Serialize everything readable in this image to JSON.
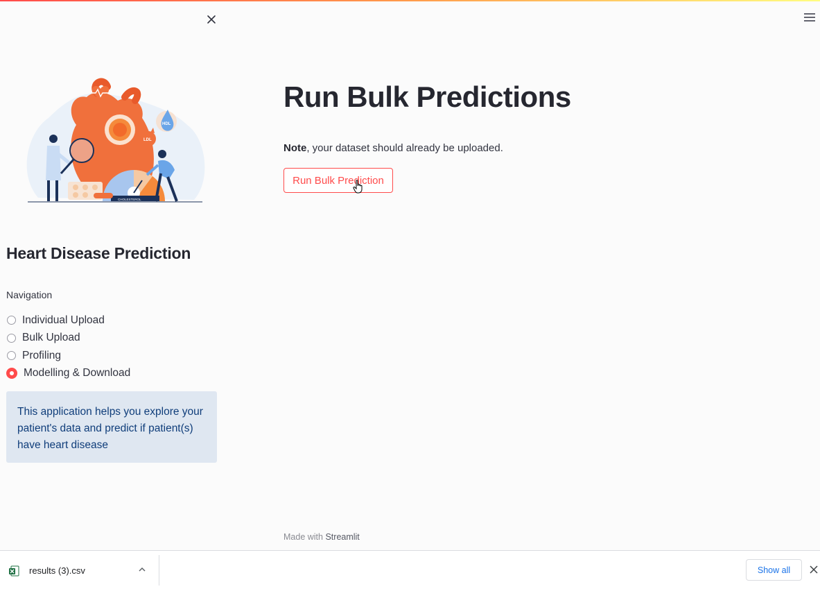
{
  "sidebar": {
    "title": "Heart Disease Prediction",
    "nav_label": "Navigation",
    "options": [
      "Individual Upload",
      "Bulk Upload",
      "Profiling",
      "Modelling & Download"
    ],
    "selected": "Modelling & Download",
    "info": "This application helps you explore your patient's data and predict if patient(s) have heart disease",
    "illustration_texts": {
      "hdl": "HDL",
      "ldl": "LDL",
      "gauge": "CHOLESTEROL"
    }
  },
  "main": {
    "title": "Run Bulk Predictions",
    "note_bold": "Note",
    "note_rest": ", your dataset should already be uploaded.",
    "button_label": "Run Bulk Prediction"
  },
  "footer": {
    "prefix": "Made with",
    "brand": "Streamlit"
  },
  "download_bar": {
    "filename": "results (3).csv",
    "show_all_label": "Show all"
  },
  "colors": {
    "accent": "#ff4b4b",
    "info_bg": "#dfe7f1",
    "info_text": "#0f3d7a",
    "link_blue": "#1a73e8"
  }
}
